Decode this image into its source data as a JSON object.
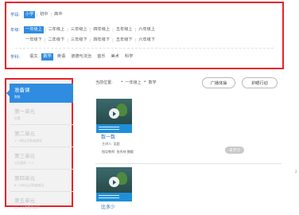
{
  "filters": {
    "stage": {
      "label": "学段:",
      "options": [
        "小学",
        "初中",
        "高中"
      ],
      "selected": 0
    },
    "grade": {
      "label": "年级:",
      "row1": [
        "一年级上",
        "二年级上",
        "三年级上",
        "四年级上",
        "五年级上",
        "六年级上"
      ],
      "row2": [
        "一年级下",
        "二年级下",
        "三年级下",
        "四年级下",
        "五年级下",
        "六年级下"
      ],
      "selected": 0
    },
    "subject": {
      "label": "学科:",
      "options": [
        "语文",
        "数学",
        "英语",
        "道德与法治",
        "音乐",
        "美术",
        "科学"
      ],
      "selected": 1
    }
  },
  "sidebar": {
    "active": {
      "title": "准备课",
      "subtitle": "数数"
    },
    "units": [
      {
        "title": "第一单元",
        "subtitle": "位置"
      },
      {
        "title": "第二单元",
        "subtitle": "1~5的认识和加减法"
      },
      {
        "title": "第三单元",
        "subtitle": "认识图形（一）"
      },
      {
        "title": "第四单元",
        "subtitle": "6~10的认识和加减法"
      },
      {
        "title": "第五单元",
        "subtitle": "11~20各数的认识"
      }
    ]
  },
  "breadcrumb": {
    "label": "当前位置:",
    "sep": "•",
    "grade": "一年级上",
    "subject": "数学"
  },
  "buttons": {
    "exercise": "广播体操",
    "eye": "护眼行动"
  },
  "cards": [
    {
      "title": "数一数",
      "speaker_label": "主讲人:",
      "speaker": "吴超",
      "teachers_label": "指导教师:",
      "teachers": "张秀林 魏樱",
      "status": "未学习"
    },
    {
      "title": "比多少"
    }
  ],
  "edge_glyph": "2"
}
